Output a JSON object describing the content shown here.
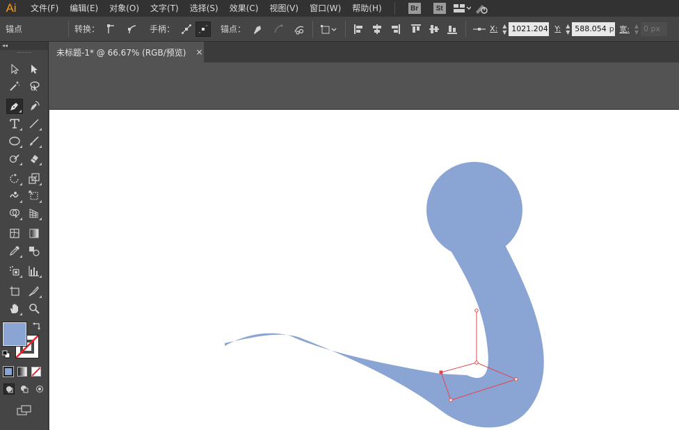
{
  "app": {
    "logo": "Ai"
  },
  "menu": [
    "文件(F)",
    "编辑(E)",
    "对象(O)",
    "文字(T)",
    "选择(S)",
    "效果(C)",
    "视图(V)",
    "窗口(W)",
    "帮助(H)"
  ],
  "menubar_badges": {
    "bridge": "Br",
    "stock": "St"
  },
  "controlbar": {
    "anchor_label": "锚点",
    "convert_label": "转换：",
    "handles_label": "手柄：",
    "anchors_label": "锚点：",
    "x_label": "X:",
    "x_value": "1021.204",
    "y_label": "Y:",
    "y_value": "588.054",
    "y_unit": "p",
    "w_label": "宽:",
    "w_value": "0 px"
  },
  "toolbox": {
    "collapse": "◂◂"
  },
  "document": {
    "tab_title": "未标题-1* @ 66.67% (RGB/预览)",
    "close": "×"
  },
  "colors": {
    "fill": "#8aa4d4",
    "accent": "#ff9a00",
    "path_selection": "#e8434a",
    "stroke_swatch": "#4a4a4a"
  },
  "artwork": {
    "shape_color": "#8aa4d4",
    "selection_color": "#e8434a"
  }
}
